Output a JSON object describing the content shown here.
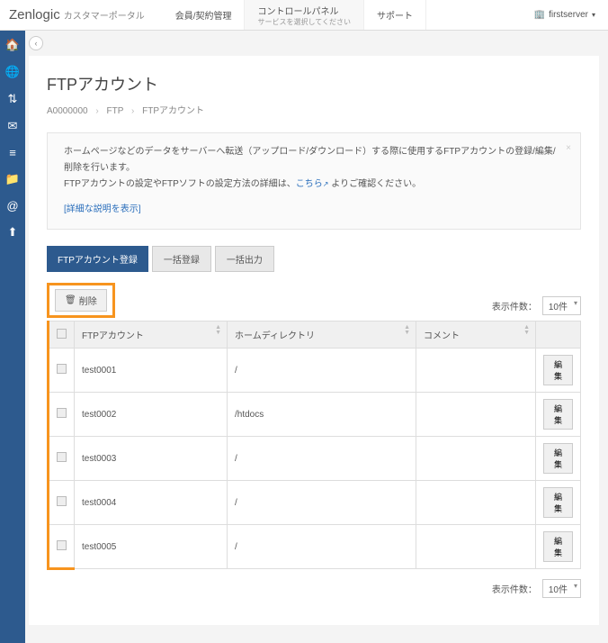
{
  "header": {
    "logo": "Zenlogic",
    "logo_sub": "カスタマーポータル",
    "nav": [
      {
        "label": "会員/契約管理"
      },
      {
        "label": "コントロールパネル",
        "sub": "サービスを選択してください"
      },
      {
        "label": "サポート"
      }
    ],
    "user": "firstserver"
  },
  "page": {
    "title": "FTPアカウント",
    "breadcrumb": {
      "acct": "A0000000",
      "mid": "FTP",
      "cur": "FTPアカウント"
    }
  },
  "info": {
    "line1": "ホームページなどのデータをサーバーへ転送（アップロード/ダウンロード）する際に使用するFTPアカウントの登録/編集/削除を行います。",
    "line2a": "FTPアカウントの設定やFTPソフトの設定方法の詳細は、",
    "link": "こちら",
    "line2b": " よりご確認ください。",
    "detail": "[詳細な説明を表示]"
  },
  "buttons": {
    "register": "FTPアカウント登録",
    "bulk_reg": "一括登録",
    "bulk_out": "一括出力",
    "delete": "削除"
  },
  "pager": {
    "label": "表示件数：",
    "value": "10件"
  },
  "table": {
    "headers": {
      "acct": "FTPアカウント",
      "home": "ホームディレクトリ",
      "comment": "コメント"
    },
    "edit": "編集",
    "rows": [
      {
        "acct": "test0001",
        "home": "/",
        "comment": ""
      },
      {
        "acct": "test0002",
        "home": "/htdocs",
        "comment": ""
      },
      {
        "acct": "test0003",
        "home": "/",
        "comment": ""
      },
      {
        "acct": "test0004",
        "home": "/",
        "comment": ""
      },
      {
        "acct": "test0005",
        "home": "/",
        "comment": ""
      }
    ]
  }
}
